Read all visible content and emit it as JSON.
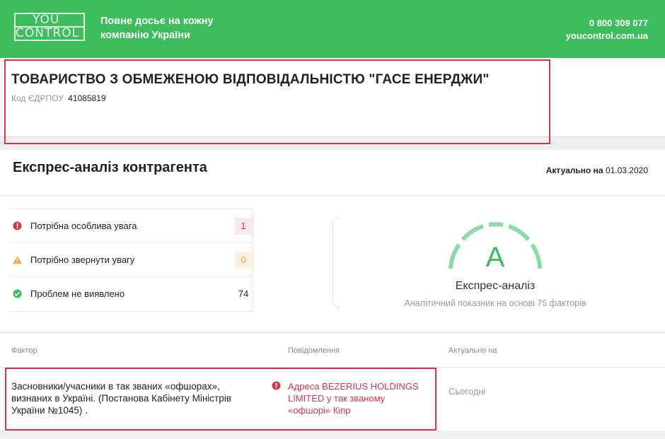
{
  "header": {
    "logo_line1": "YOU",
    "logo_line2": "CONTROL",
    "tagline": "Повне досьє на кожну компанію України",
    "phone": "0 800 309 077",
    "site": "youcontrol.com.ua",
    "brand_color": "#3ebd5c"
  },
  "company": {
    "name": "ТОВАРИСТВО З ОБМЕЖЕНОЮ ВІДПОВІДАЛЬНІСТЮ \"ГАСЕ ЕНЕРДЖИ\"",
    "code_label": "Код ЄДРПОУ",
    "code_value": "41085819"
  },
  "express": {
    "title": "Експрес-аналіз контрагента",
    "actual_label": "Актуально на",
    "actual_date": "01.03.2020",
    "stats": [
      {
        "icon": "alert-circle-icon",
        "label": "Потрібна особлива увага",
        "count": "1",
        "color": "#d23845"
      },
      {
        "icon": "warning-triangle-icon",
        "label": "Потрібно звернути увагу",
        "count": "0",
        "color": "#f0a23a"
      },
      {
        "icon": "check-circle-icon",
        "label": "Проблем не виявлено",
        "count": "74",
        "color": "#3ebd5c"
      }
    ],
    "grade": "A",
    "gauge_caption": "Експрес-аналіз",
    "gauge_sub": "Аналітичний показник на основі 75 факторів"
  },
  "table": {
    "headers": [
      "Фактор",
      "Повідомлення",
      "Актуально на"
    ],
    "rows": [
      {
        "factor": "Засновники/учасники в так званих «офшорах», визнаних в Україні. (Постанова Кабінету Міністрів України №1045) .",
        "message": "Адреса BEZERIUS HOLDINGS LIMITED у так званому «офшорі» Кіпр",
        "date": "Сьогодні"
      }
    ]
  }
}
